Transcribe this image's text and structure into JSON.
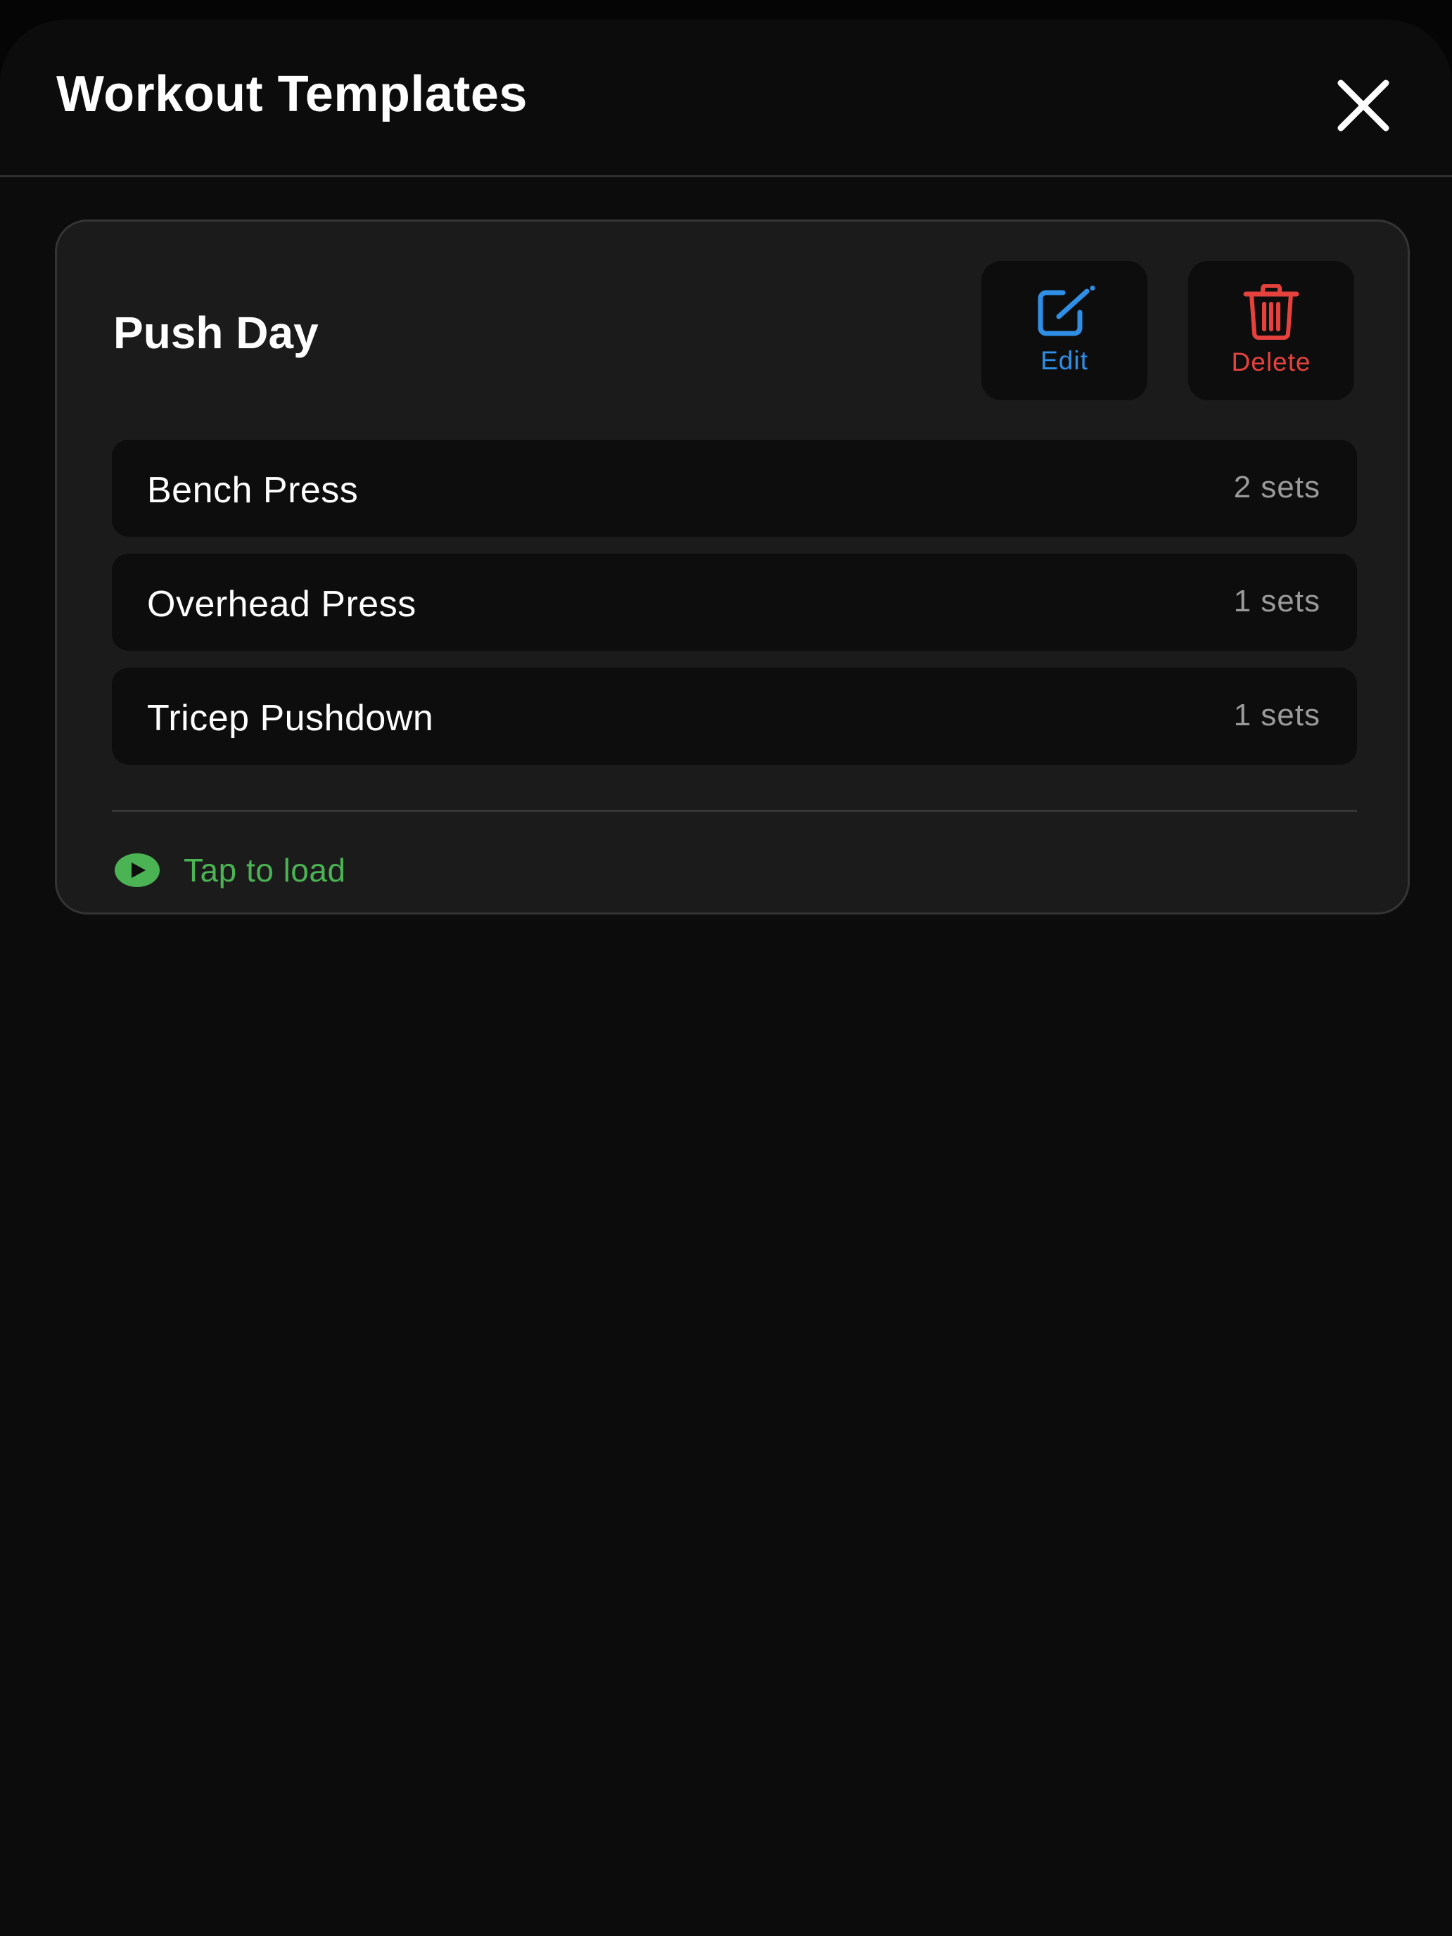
{
  "header": {
    "title": "Workout Templates",
    "close_icon": "close-icon"
  },
  "template": {
    "name": "Push Day",
    "edit_label": "Edit",
    "delete_label": "Delete",
    "exercises": [
      {
        "name": "Bench Press",
        "sets": "2 sets"
      },
      {
        "name": "Overhead Press",
        "sets": "1 sets"
      },
      {
        "name": "Tricep Pushdown",
        "sets": "1 sets"
      }
    ],
    "load_label": "Tap to load"
  },
  "colors": {
    "background": "#0c0c0c",
    "card": "#1b1b1b",
    "row": "#0d0d0d",
    "edit_accent": "#2f8fe6",
    "delete_accent": "#e5423e",
    "load_accent": "#4bb354",
    "muted_text": "#9a9a9a"
  }
}
